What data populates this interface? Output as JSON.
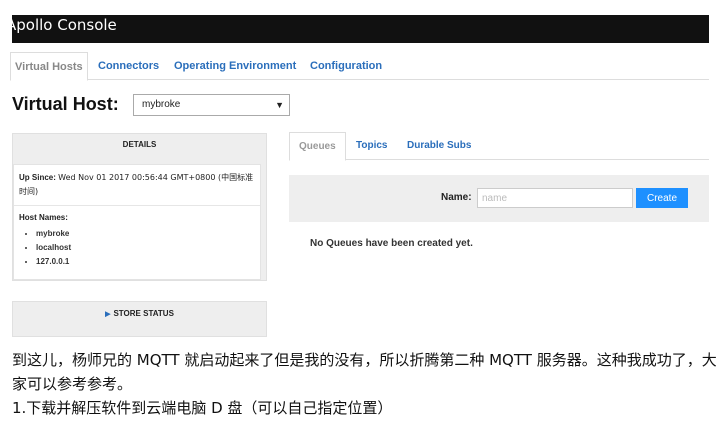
{
  "window": {
    "title": "Apollo Console"
  },
  "nav": {
    "tabs": [
      {
        "label": "Virtual Hosts",
        "active": true
      },
      {
        "label": "Connectors",
        "active": false
      },
      {
        "label": "Operating Environment",
        "active": false
      },
      {
        "label": "Configuration",
        "active": false
      }
    ]
  },
  "vhost": {
    "label": "Virtual Host:",
    "selected": "mybroke"
  },
  "details": {
    "heading": "DETAILS",
    "up_since_label": "Up Since:",
    "up_since_value": "Wed Nov 01 2017 00:56:44 GMT+0800 (中国标准时间)",
    "host_names_label": "Host Names:",
    "host_names": [
      "mybroke",
      "localhost",
      "127.0.0.1"
    ]
  },
  "store_status": {
    "label": "STORE STATUS"
  },
  "subtabs": [
    {
      "label": "Queues",
      "active": true
    },
    {
      "label": "Topics",
      "active": false
    },
    {
      "label": "Durable Subs",
      "active": false
    }
  ],
  "create": {
    "name_label": "Name:",
    "placeholder": "name",
    "button_label": "Create"
  },
  "queues": {
    "empty_message": "No Queues have been created yet."
  },
  "article": {
    "paragraphs": [
      "到这儿，杨师兄的 MQTT 就启动起来了但是我的没有，所以折腾第二种 MQTT 服务器。这种我成功了，大家可以参考参考。",
      "1.下载并解压软件到云端电脑 D 盘（可以自己指定位置）"
    ]
  },
  "colors": {
    "accent": "#2a6ebb",
    "button": "#1e90ff",
    "titlebar": "#111111",
    "panel": "#eeeeee"
  },
  "icons": {
    "select_caret": "chevron-down-icon",
    "store_arrow": "triangle-right-icon"
  }
}
